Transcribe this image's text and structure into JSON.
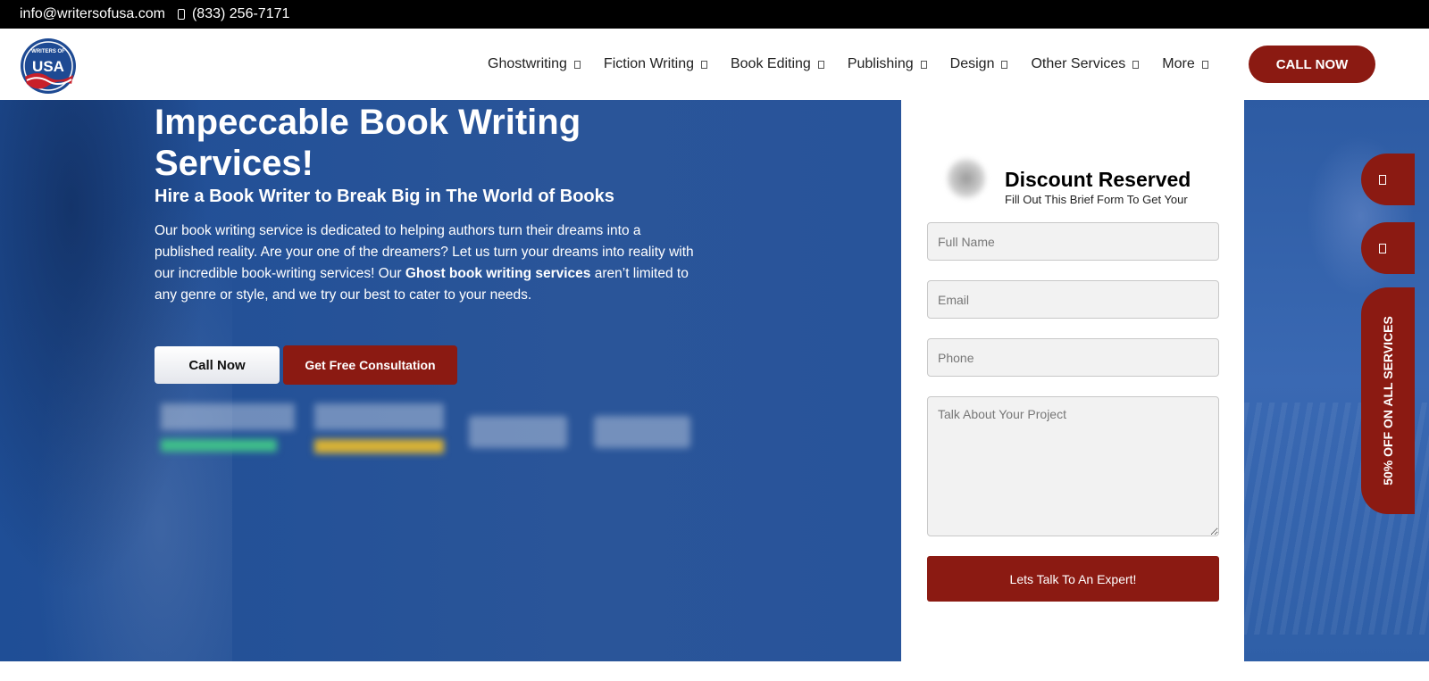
{
  "topbar": {
    "email": "info@writersofusa.com",
    "phone": "(833) 256-7171"
  },
  "header": {
    "logo_text": "USA",
    "logo_arc": "WRITERS OF",
    "nav": [
      {
        "label": "Ghostwriting"
      },
      {
        "label": "Fiction Writing"
      },
      {
        "label": "Book Editing"
      },
      {
        "label": "Publishing"
      },
      {
        "label": "Design"
      },
      {
        "label": "Other Services"
      },
      {
        "label": "More"
      }
    ],
    "cta_label": "CALL NOW"
  },
  "hero": {
    "title_regular": "Impeccable ",
    "title_bold": "Book Writing Services!",
    "subtitle": "Hire a Book Writer to Break Big in The World of Books",
    "desc_part1": "Our book writing service is dedicated to helping authors turn their dreams into a published reality. Are your one of the dreamers? Let us turn your dreams into reality with our incredible book-writing services! Our ",
    "desc_bold": "Ghost book writing services",
    "desc_part2": " aren’t limited to any genre or style, and we try our best to cater to your needs.",
    "call_label": "Call Now",
    "consult_label": "Get Free Consultation"
  },
  "form": {
    "title": "Discount Reserved",
    "subtitle": "Fill Out This Brief Form To Get Your",
    "name_placeholder": "Full Name",
    "email_placeholder": "Email",
    "phone_placeholder": "Phone",
    "message_placeholder": "Talk About Your Project",
    "submit_label": "Lets Talk To An Expert!"
  },
  "side": {
    "tab_label": "50% OFF ON ALL SERVICES"
  },
  "colors": {
    "brand_red": "#8b1a12",
    "hero_blue": "#2a5599",
    "black": "#000000"
  }
}
